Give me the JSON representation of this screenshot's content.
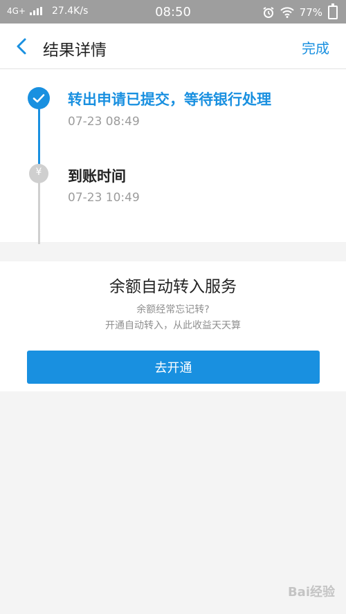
{
  "status_bar": {
    "network": "4G+",
    "speed": "27.4K/s",
    "time": "08:50",
    "battery": "77%"
  },
  "nav": {
    "title": "结果详情",
    "done_label": "完成"
  },
  "timeline": {
    "steps": [
      {
        "title": "转出申请已提交，等待银行处理",
        "time": "07-23 08:49",
        "status": "done"
      },
      {
        "title": "到账时间",
        "time": "07-23 10:49",
        "status": "pending",
        "icon_text": "¥"
      }
    ]
  },
  "promo": {
    "title": "余额自动转入服务",
    "line1": "余额经常忘记转?",
    "line2": "开通自动转入，从此收益天天算",
    "button_label": "去开通"
  },
  "watermark": {
    "text": "Bai经验"
  },
  "colors": {
    "accent": "#1990e0",
    "status_bar": "#9e9e9e",
    "page_bg": "#f4f4f4"
  }
}
